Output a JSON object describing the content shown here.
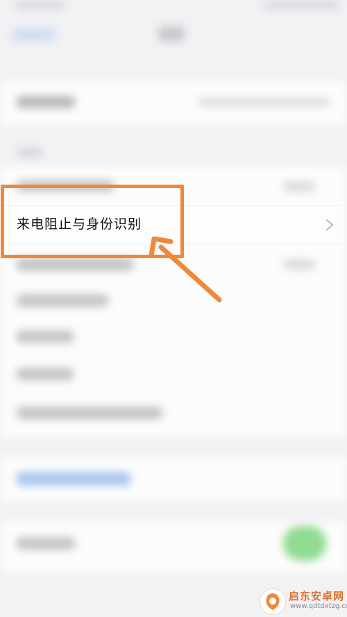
{
  "settings": {
    "focused_row_label": "来电阻止与身份识别"
  },
  "colors": {
    "highlight": "#f0883a",
    "background": "#f2f2f5",
    "link_blur": "#a9c7ef",
    "toggle_on": "#8fdb8f"
  },
  "watermark": {
    "brand": "启东安卓网",
    "url": "www.qdtdxtzg.com"
  },
  "icons": {
    "row_chevron": "chevron-right-icon",
    "annotation_arrow": "arrow-pointer-icon",
    "watermark_logo": "logo-icon"
  }
}
